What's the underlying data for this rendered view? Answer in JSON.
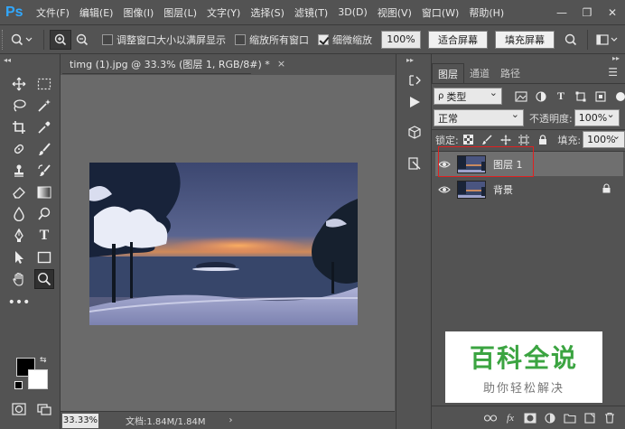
{
  "app": {
    "logo": "Ps",
    "menu": [
      "文件(F)",
      "编辑(E)",
      "图像(I)",
      "图层(L)",
      "文字(Y)",
      "选择(S)",
      "滤镜(T)",
      "3D(D)",
      "视图(V)",
      "窗口(W)",
      "帮助(H)"
    ],
    "window_controls": {
      "minimize": "—",
      "restore": "❐",
      "close": "✕"
    }
  },
  "options_bar": {
    "resize_windows_label": "调整窗口大小以满屏显示",
    "resize_windows_checked": false,
    "zoom_all_label": "缩放所有窗口",
    "zoom_all_checked": false,
    "scrubby_zoom_label": "细微缩放",
    "scrubby_zoom_checked": true,
    "zoom_percent": "100%",
    "fit_screen_label": "适合屏幕",
    "fill_screen_label": "填充屏幕"
  },
  "document": {
    "tab_title": "timg (1).jpg @ 33.3% (图层 1, RGB/8#) *",
    "tab_close": "×",
    "zoom": "33.33%",
    "info": "文档:1.84M/1.84M",
    "status_arrow": "›"
  },
  "layers_panel": {
    "tabs": [
      "图层",
      "通道",
      "路径"
    ],
    "active_tab": 0,
    "filter_label": "类型",
    "blend_mode": "正常",
    "opacity_label": "不透明度:",
    "opacity_value": "100%",
    "lock_label": "锁定:",
    "fill_label": "填充:",
    "fill_value": "100%",
    "layers": [
      {
        "name": "图层 1",
        "visible": true,
        "selected": true,
        "locked": false
      },
      {
        "name": "背景",
        "visible": true,
        "selected": false,
        "locked": true
      }
    ]
  },
  "watermark": {
    "title": "百科全说",
    "subtitle": "助你轻松解决",
    "color": "#3ba441"
  },
  "colors": {
    "foreground": "#000000",
    "background": "#ffffff",
    "highlight_box": "#e02020"
  }
}
